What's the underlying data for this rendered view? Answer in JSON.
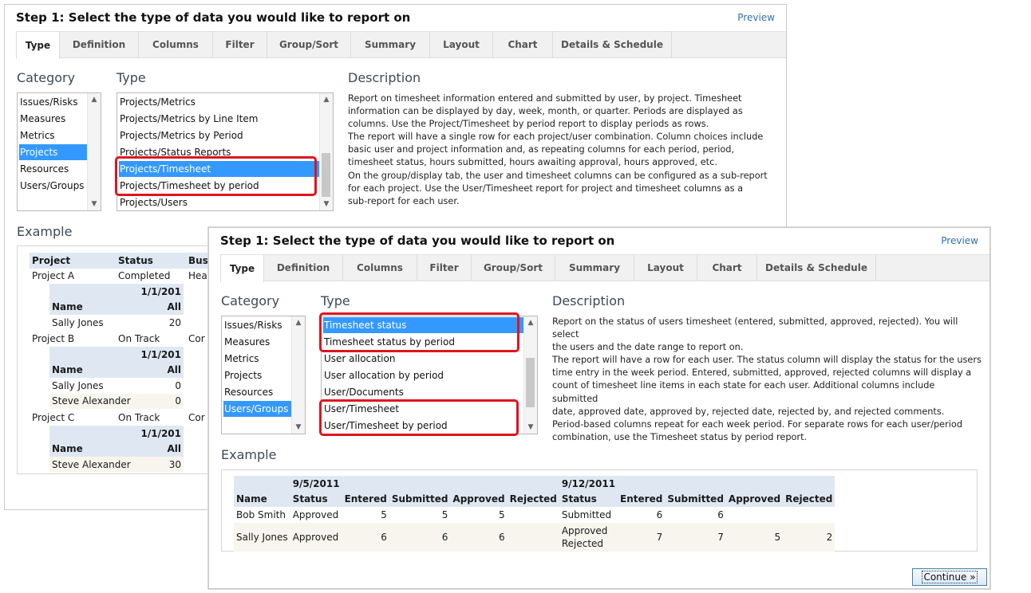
{
  "back": {
    "title": "Step 1: Select the type of data you would like to report on",
    "preview": "Preview",
    "tabs": [
      "Type",
      "Definition",
      "Columns",
      "Filter",
      "Group/Sort",
      "Summary",
      "Layout",
      "Chart",
      "Details & Schedule"
    ],
    "category_label": "Category",
    "type_label": "Type",
    "description_label": "Description",
    "example_label": "Example",
    "categories": [
      "Issues/Risks",
      "Measures",
      "Metrics",
      "Projects",
      "Resources",
      "Users/Groups"
    ],
    "types": [
      "Projects/Metrics",
      "Projects/Metrics by Line Item",
      "Projects/Metrics by Period",
      "Projects/Status Reports",
      "Projects/Timesheet",
      "Projects/Timesheet by period",
      "Projects/Users"
    ],
    "description_lines": [
      "Report on timesheet information entered and submitted by user, by project. Timesheet",
      "information can be displayed by day, week, month, or quarter. Periods are displayed as",
      "columns. Use the Project/Timesheet by period report to display periods as rows.",
      "The report will have a single row for each project/user combination. Column choices include",
      "basic user and project information and, as repeating columns for each period, period,",
      "timesheet status, hours submitted, hours awaiting approval, hours approved, etc.",
      "On the group/display tab, the user and timesheet columns can be configured as a sub-report",
      "for each project. Use the User/Timesheet report for project and timesheet columns as a",
      "sub-report for each user."
    ],
    "example": {
      "h_project": "Project",
      "h_status": "Status",
      "h_bus": "Bus",
      "pA": "Project A",
      "pA_status": "Completed",
      "pA_bus": "Hea",
      "pB": "Project B",
      "pB_status": "On Track",
      "pB_bus": "Cor",
      "pC": "Project C",
      "pC_status": "On Track",
      "pC_bus": "Cor",
      "date": "1/1/201",
      "h_name": "Name",
      "h_all": "All",
      "sally": "Sally Jones",
      "sally_a": "20",
      "sally_b": "0",
      "steve": "Steve Alexander",
      "steve_b": "0",
      "steve_c": "30"
    }
  },
  "front": {
    "title": "Step 1: Select the type of data you would like to report on",
    "preview": "Preview",
    "tabs": [
      "Type",
      "Definition",
      "Columns",
      "Filter",
      "Group/Sort",
      "Summary",
      "Layout",
      "Chart",
      "Details & Schedule"
    ],
    "category_label": "Category",
    "type_label": "Type",
    "description_label": "Description",
    "example_label": "Example",
    "categories": [
      "Issues/Risks",
      "Measures",
      "Metrics",
      "Projects",
      "Resources",
      "Users/Groups"
    ],
    "types": [
      "Timesheet status",
      "Timesheet status by period",
      "User allocation",
      "User allocation by period",
      "User/Documents",
      "User/Timesheet",
      "User/Timesheet by period"
    ],
    "description_lines": [
      "Report on the status of users timesheet (entered, submitted, approved, rejected). You will select",
      "the users and the date range to report on.",
      "The report will have a row for each user. The status column will display the status for the users",
      "time entry in the week period. Entered, submitted, approved, rejected columns will display a",
      "count of timesheet line items in each state for each user. Additional columns include submitted",
      "date, approved date, approved by, rejected date, rejected by, and rejected comments.",
      "Period-based columns repeat for each week period. For separate rows for each user/period",
      "combination, use the Timesheet status by period report."
    ],
    "example": {
      "d1": "9/5/2011",
      "d2": "9/12/2011",
      "headers": [
        "Name",
        "Status",
        "Entered",
        "Submitted",
        "Approved",
        "Rejected",
        "Status",
        "Entered",
        "Submitted",
        "Approved",
        "Rejected"
      ],
      "r1": [
        "Bob Smith",
        "Approved",
        "5",
        "5",
        "5",
        "",
        "Submitted",
        "6",
        "6",
        "",
        ""
      ],
      "r2": [
        "Sally Jones",
        "Approved",
        "6",
        "6",
        "6",
        "",
        "Approved",
        "7",
        "7",
        "5",
        "2"
      ],
      "r2_rejected": "Rejected"
    },
    "continue": "Continue »"
  }
}
